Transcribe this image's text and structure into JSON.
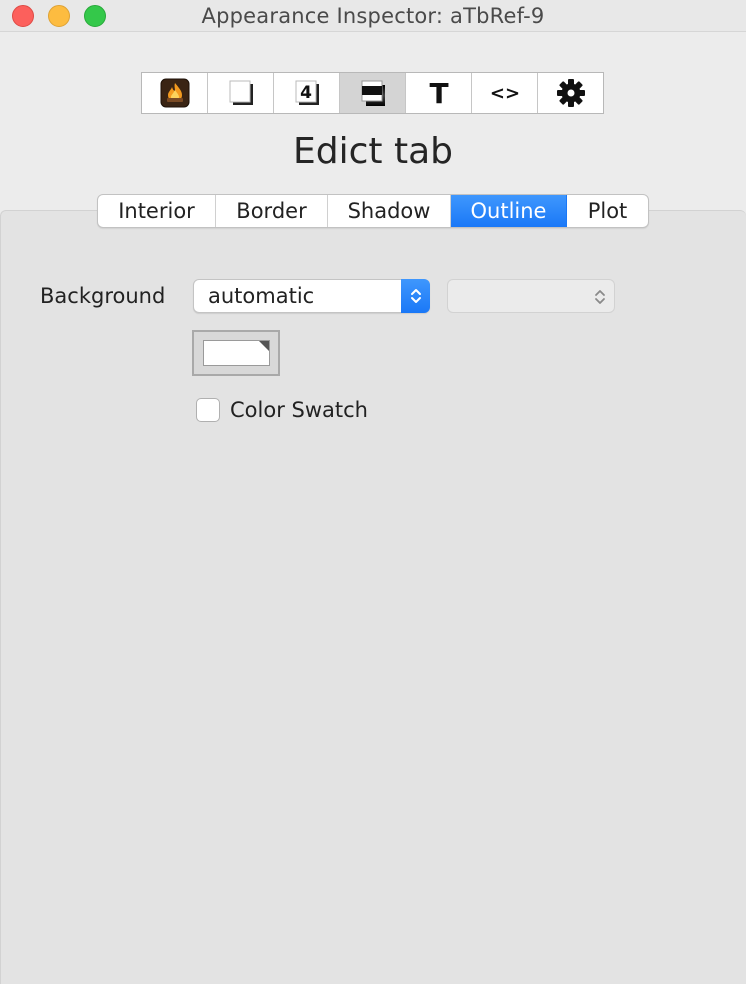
{
  "window": {
    "title": "Appearance Inspector: aTbRef-9"
  },
  "toolbar": {
    "buttons": [
      {
        "icon": "tinderbox-flame-icon",
        "selected": false
      },
      {
        "icon": "note-shape-icon",
        "selected": false
      },
      {
        "icon": "badge-number-icon",
        "glyph": "4",
        "selected": false
      },
      {
        "icon": "shadow-box-icon",
        "selected": true
      },
      {
        "icon": "text-icon",
        "glyph": "T",
        "selected": false
      },
      {
        "icon": "code-angle-icon",
        "glyph": "<>",
        "selected": false
      },
      {
        "icon": "gear-icon",
        "selected": false
      }
    ]
  },
  "heading": "Edict tab",
  "tabs": [
    {
      "label": "Interior",
      "active": false
    },
    {
      "label": "Border",
      "active": false
    },
    {
      "label": "Shadow",
      "active": false
    },
    {
      "label": "Outline",
      "active": true
    },
    {
      "label": "Plot",
      "active": false
    }
  ],
  "background": {
    "label": "Background",
    "selected_value": "automatic",
    "secondary_value": ""
  },
  "color_swatch": {
    "label": "Color Swatch",
    "checked": false,
    "well_color": "#ffffff"
  },
  "colors": {
    "accent": "#1a78f7",
    "panel": "#e3e3e3",
    "window": "#ececec"
  }
}
